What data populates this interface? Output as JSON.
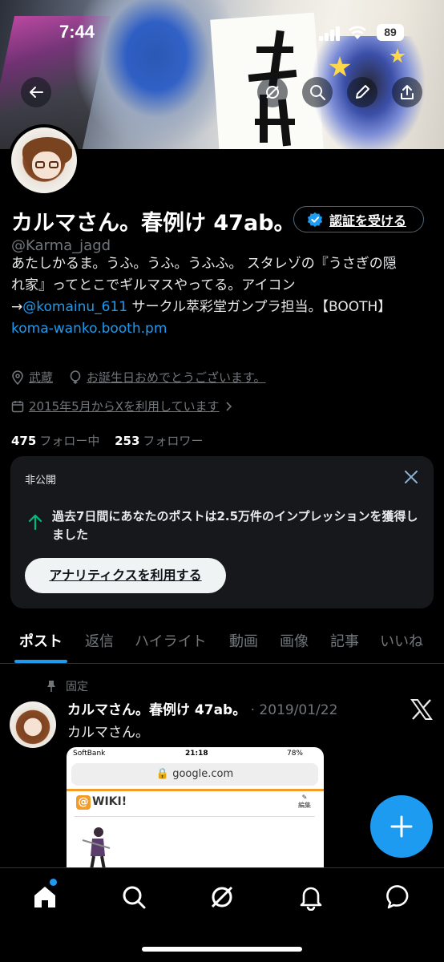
{
  "status_bar": {
    "time": "7:44",
    "battery": "89"
  },
  "header": {
    "icons": [
      "back-arrow-icon",
      "grok-icon",
      "search-icon",
      "edit-icon",
      "share-icon"
    ]
  },
  "profile": {
    "name": "カルマさん。春例け 47ab。",
    "verify_button": "認証を受ける",
    "handle": "@Karma_jagd",
    "bio_line1": "あたしかるま。うふ。うふ。うふふ。 スタレゾの『うさぎの隠",
    "bio_line2": "れ家』ってとこでギルマスやってる。アイコン",
    "bio_arrow": "→",
    "bio_mention": "@komainu_611",
    "bio_line3_rest": " サークル萃彩堂ガンプラ担当。【BOOTH】",
    "bio_link": "koma-wanko.booth.pm",
    "location": "武蔵",
    "birthday": "お誕生日おめでとうございます。",
    "joined": "2015年5月からXを利用しています",
    "following_count": "475",
    "following_label": "フォロー中",
    "followers_count": "253",
    "followers_label": "フォロワー"
  },
  "analytics_card": {
    "private_label": "非公開",
    "message": "過去7日間にあなたのポストは2.5万件のインプレッションを獲得しました",
    "button": "アナリティクスを利用する"
  },
  "tabs": [
    {
      "label": "ポスト",
      "active": true
    },
    {
      "label": "返信"
    },
    {
      "label": "ハイライト"
    },
    {
      "label": "動画"
    },
    {
      "label": "画像"
    },
    {
      "label": "記事"
    },
    {
      "label": "いいね"
    }
  ],
  "pinned_post": {
    "pinned_label": "固定",
    "author": "カルマさん。春例け 47ab。",
    "date": "· 2019/01/22",
    "text": "カルマさん。",
    "embed": {
      "carrier": "SoftBank",
      "time": "21:18",
      "battery": "78%",
      "url": "google.com",
      "site": "WIKI!",
      "edit": "編集"
    }
  },
  "colors": {
    "accent": "#1d9bf0",
    "background": "#000000",
    "muted": "#71767b"
  }
}
